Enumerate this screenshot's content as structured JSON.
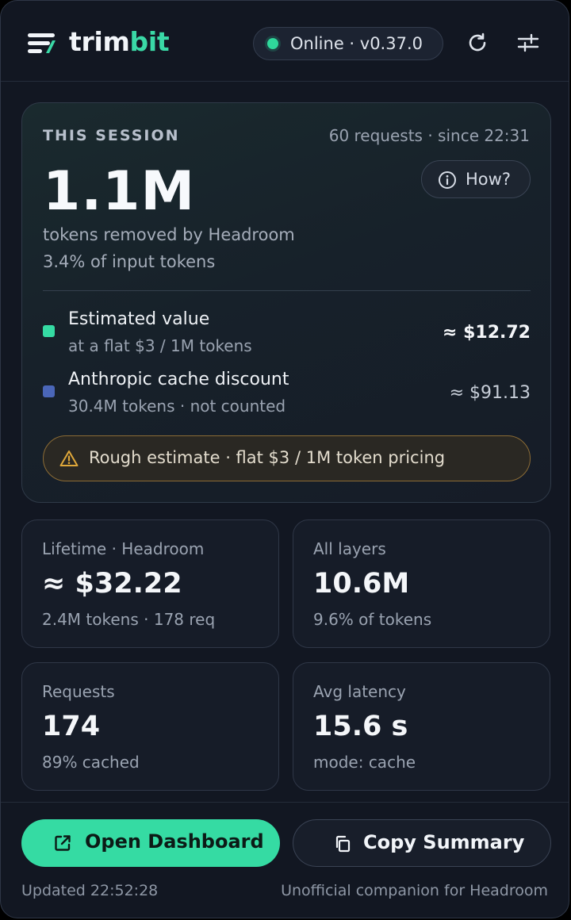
{
  "app": {
    "name_part1": "trim",
    "name_part2": "bit"
  },
  "status": {
    "text": "Online · v0.37.0",
    "color": "#2fd89b"
  },
  "session": {
    "eyebrow": "THIS SESSION",
    "meta": "60 requests · since 22:31",
    "how_label": "How?",
    "big_value": "1.1M",
    "big_sub1": "tokens removed by Headroom",
    "big_sub2": "3.4% of input tokens",
    "rows": [
      {
        "title": "Estimated value",
        "sub": "at a flat $3 / 1M tokens",
        "value": "≈ $12.72",
        "color": "#35dba3"
      },
      {
        "title": "Anthropic cache discount",
        "sub": "30.4M tokens · not counted",
        "value": "≈ $91.13",
        "color": "#4a66b8"
      }
    ],
    "warning": "Rough estimate · flat $3 / 1M token pricing"
  },
  "stats": [
    {
      "label": "Lifetime · Headroom",
      "value": "≈ $32.22",
      "foot": "2.4M tokens · 178 req"
    },
    {
      "label": "All layers",
      "value": "10.6M",
      "foot": "9.6% of tokens"
    },
    {
      "label": "Requests",
      "value": "174",
      "foot": "89% cached"
    },
    {
      "label": "Avg latency",
      "value": "15.6 s",
      "foot": "mode: cache"
    }
  ],
  "footer": {
    "open_dashboard": "Open Dashboard",
    "copy_summary": "Copy Summary",
    "updated": "Updated 22:52:28",
    "tagline": "Unofficial companion for Headroom"
  },
  "colors": {
    "accent": "#35dba3",
    "warning_border": "#8c6c35"
  }
}
